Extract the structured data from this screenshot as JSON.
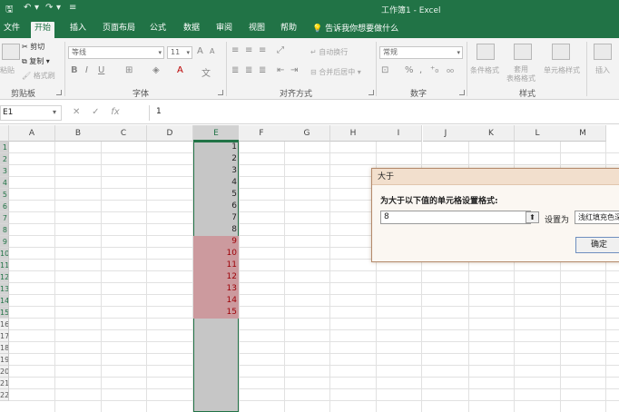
{
  "titlebar": {
    "save_icon": "save-icon",
    "undo_icon": "undo-icon",
    "redo_icon": "redo-icon",
    "window_title": "工作簿1  -  Excel"
  },
  "tabs": [
    {
      "label": "文件"
    },
    {
      "label": "开始"
    },
    {
      "label": "插入"
    },
    {
      "label": "页面布局"
    },
    {
      "label": "公式"
    },
    {
      "label": "数据"
    },
    {
      "label": "审阅"
    },
    {
      "label": "视图"
    },
    {
      "label": "帮助"
    }
  ],
  "tell_me": "告诉我你想要做什么",
  "ribbon": {
    "clipboard": {
      "paste": "粘贴",
      "cut": "剪切",
      "copy": "复制",
      "format_painter": "格式刷",
      "label": "剪贴板"
    },
    "font": {
      "name": "等线",
      "size": "11",
      "label": "字体"
    },
    "alignment": {
      "wrap": "自动换行",
      "merge": "合并后居中",
      "label": "对齐方式"
    },
    "number": {
      "format": "常规",
      "label": "数字"
    },
    "styles": {
      "conditional": "条件格式",
      "table": "套用\n表格格式",
      "cell": "单元格样式",
      "label": "样式"
    },
    "cells": {
      "insert": "插入"
    }
  },
  "formula_bar": {
    "name_box": "E1",
    "fx": "fx",
    "value": "1"
  },
  "grid": {
    "columns": [
      "A",
      "B",
      "C",
      "D",
      "E",
      "F",
      "G",
      "H",
      "I",
      "J",
      "K",
      "L",
      "M"
    ],
    "selected_column": "E",
    "row_numbers": [
      "1",
      "2",
      "3",
      "4",
      "5",
      "6",
      "7",
      "8",
      "9",
      "10",
      "11",
      "12",
      "13",
      "14",
      "15",
      "16",
      "17",
      "18",
      "19",
      "20",
      "21",
      "22"
    ],
    "column_e_values": [
      "1",
      "2",
      "3",
      "4",
      "5",
      "6",
      "7",
      "8",
      "9",
      "10",
      "11",
      "12",
      "13",
      "14",
      "15"
    ],
    "highlight_threshold": 8,
    "highlight_fill": "#cc9a9e",
    "highlight_text": "#9c0006"
  },
  "dialog": {
    "title": "大于",
    "prompt": "为大于以下值的单元格设置格式:",
    "value": "8",
    "set_as_label": "设置为",
    "format_option": "浅红填充色深红色文本",
    "ok_label": "确定"
  },
  "colors": {
    "excel_green": "#217346",
    "selection_gray": "#c6c6c6"
  }
}
